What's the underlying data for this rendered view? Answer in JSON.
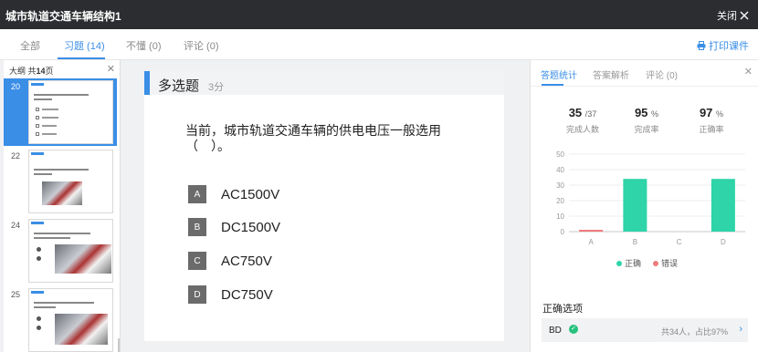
{
  "window": {
    "title": "城市轨道交通车辆结构1",
    "close_label": "关闭"
  },
  "tabs": [
    {
      "label": "全部"
    },
    {
      "label": "习题 (14)"
    },
    {
      "label": "不懂 (0)"
    },
    {
      "label": "评论 (0)"
    }
  ],
  "print_label": "打印课件",
  "outline": {
    "title_prefix": "大纲 共",
    "total_pages": "14",
    "title_suffix": "页",
    "slides": [
      {
        "num": "20",
        "active": true
      },
      {
        "num": "22",
        "active": false
      },
      {
        "num": "24",
        "active": false
      },
      {
        "num": "25",
        "active": false
      }
    ]
  },
  "question": {
    "type": "多选题",
    "score": "3分",
    "text": "当前，城市轨道交通车辆的供电电压一般选用（　）。",
    "options": [
      {
        "letter": "A",
        "text": "AC1500V"
      },
      {
        "letter": "B",
        "text": "DC1500V"
      },
      {
        "letter": "C",
        "text": "AC750V"
      },
      {
        "letter": "D",
        "text": "DC750V"
      }
    ]
  },
  "stats": {
    "tabs": [
      {
        "label": "答题统计"
      },
      {
        "label": "答案解析"
      },
      {
        "label": "评论 (0)"
      }
    ],
    "metrics": [
      {
        "value": "35",
        "unit": "/37",
        "label": "完成人数"
      },
      {
        "value": "95",
        "unit": "%",
        "label": "完成率"
      },
      {
        "value": "97",
        "unit": "%",
        "label": "正确率"
      }
    ],
    "legend": {
      "correct": "正确",
      "wrong": "错误"
    },
    "answer_title": "正确选项",
    "answer_options": "BD",
    "answer_summary": "共34人，占比97%"
  },
  "colors": {
    "accent": "#3a8ee6",
    "correct": "#2fd4a8",
    "wrong": "#ef7b7b"
  },
  "chart_data": {
    "type": "bar",
    "categories": [
      "A",
      "B",
      "C",
      "D"
    ],
    "series": [
      {
        "name": "正确",
        "values": [
          0,
          34,
          0,
          34
        ]
      },
      {
        "name": "错误",
        "values": [
          1,
          0,
          0,
          0
        ]
      }
    ],
    "yticks": [
      0,
      10,
      20,
      30,
      40,
      50
    ],
    "ylim": [
      0,
      50
    ]
  }
}
